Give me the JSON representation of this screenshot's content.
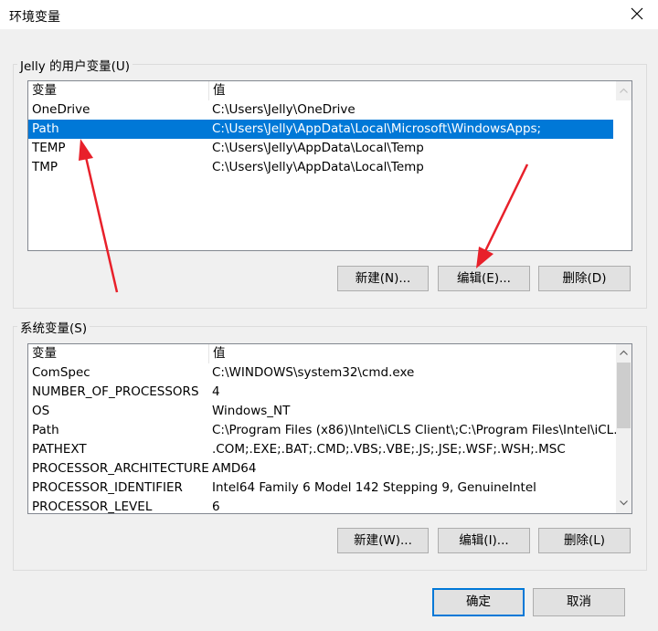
{
  "window": {
    "title": "环境变量",
    "close_icon": "close-icon"
  },
  "user_vars": {
    "group_label": "Jelly 的用户变量(U)",
    "columns": [
      "变量",
      "值"
    ],
    "rows": [
      {
        "name": "OneDrive",
        "value": "C:\\Users\\Jelly\\OneDrive",
        "selected": false
      },
      {
        "name": "Path",
        "value": "C:\\Users\\Jelly\\AppData\\Local\\Microsoft\\WindowsApps;",
        "selected": true
      },
      {
        "name": "TEMP",
        "value": "C:\\Users\\Jelly\\AppData\\Local\\Temp",
        "selected": false
      },
      {
        "name": "TMP",
        "value": "C:\\Users\\Jelly\\AppData\\Local\\Temp",
        "selected": false
      }
    ],
    "buttons": {
      "new": "新建(N)...",
      "edit": "编辑(E)...",
      "delete": "删除(D)"
    }
  },
  "system_vars": {
    "group_label": "系统变量(S)",
    "columns": [
      "变量",
      "值"
    ],
    "rows": [
      {
        "name": "ComSpec",
        "value": "C:\\WINDOWS\\system32\\cmd.exe"
      },
      {
        "name": "NUMBER_OF_PROCESSORS",
        "value": "4"
      },
      {
        "name": "OS",
        "value": "Windows_NT"
      },
      {
        "name": "Path",
        "value": "C:\\Program Files (x86)\\Intel\\iCLS Client\\;C:\\Program Files\\Intel\\iCL..."
      },
      {
        "name": "PATHEXT",
        "value": ".COM;.EXE;.BAT;.CMD;.VBS;.VBE;.JS;.JSE;.WSF;.WSH;.MSC"
      },
      {
        "name": "PROCESSOR_ARCHITECTURE",
        "value": "AMD64"
      },
      {
        "name": "PROCESSOR_IDENTIFIER",
        "value": "Intel64 Family 6 Model 142 Stepping 9, GenuineIntel"
      },
      {
        "name": "PROCESSOR_LEVEL",
        "value": "6"
      }
    ],
    "buttons": {
      "new": "新建(W)...",
      "edit": "编辑(I)...",
      "delete": "删除(L)"
    }
  },
  "footer": {
    "ok": "确定",
    "cancel": "取消"
  },
  "annotations": {
    "color": "#e8202a"
  },
  "colors": {
    "selection": "#0078d7",
    "default_button_border": "#0078d7"
  }
}
